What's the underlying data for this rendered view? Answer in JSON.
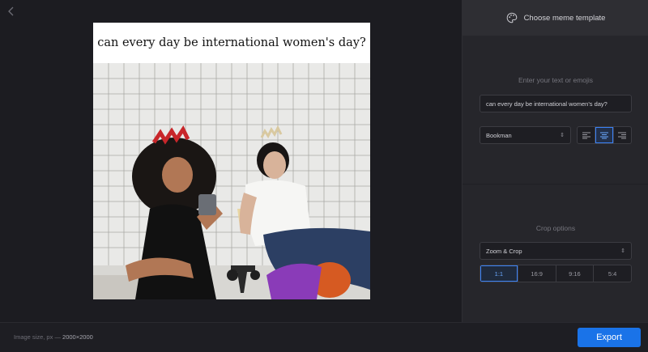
{
  "canvas": {
    "back_icon": "chevron-left-icon",
    "meme_caption": "can every day be international women's day?"
  },
  "panel": {
    "template_icon": "palette-icon",
    "template_label": "Choose meme template",
    "text_section_title": "Enter your text or emojis",
    "text_input_value": "can every day be international women's day?",
    "font_select_value": "Bookman",
    "alignment_options": [
      "align-left",
      "align-center",
      "align-right"
    ],
    "alignment_selected": "align-center",
    "crop_section_title": "Crop options",
    "crop_mode_value": "Zoom & Crop",
    "ratios": [
      "1:1",
      "16:9",
      "9:16",
      "5:4"
    ],
    "ratio_selected": "1:1"
  },
  "footer": {
    "image_size_label": "Image size, px —",
    "image_size_value": "2000×2000",
    "export_label": "Export"
  },
  "colors": {
    "background": "#1c1c21",
    "panel": "#26262b",
    "accent": "#1a73e8",
    "active_outline": "#3b82f6"
  }
}
